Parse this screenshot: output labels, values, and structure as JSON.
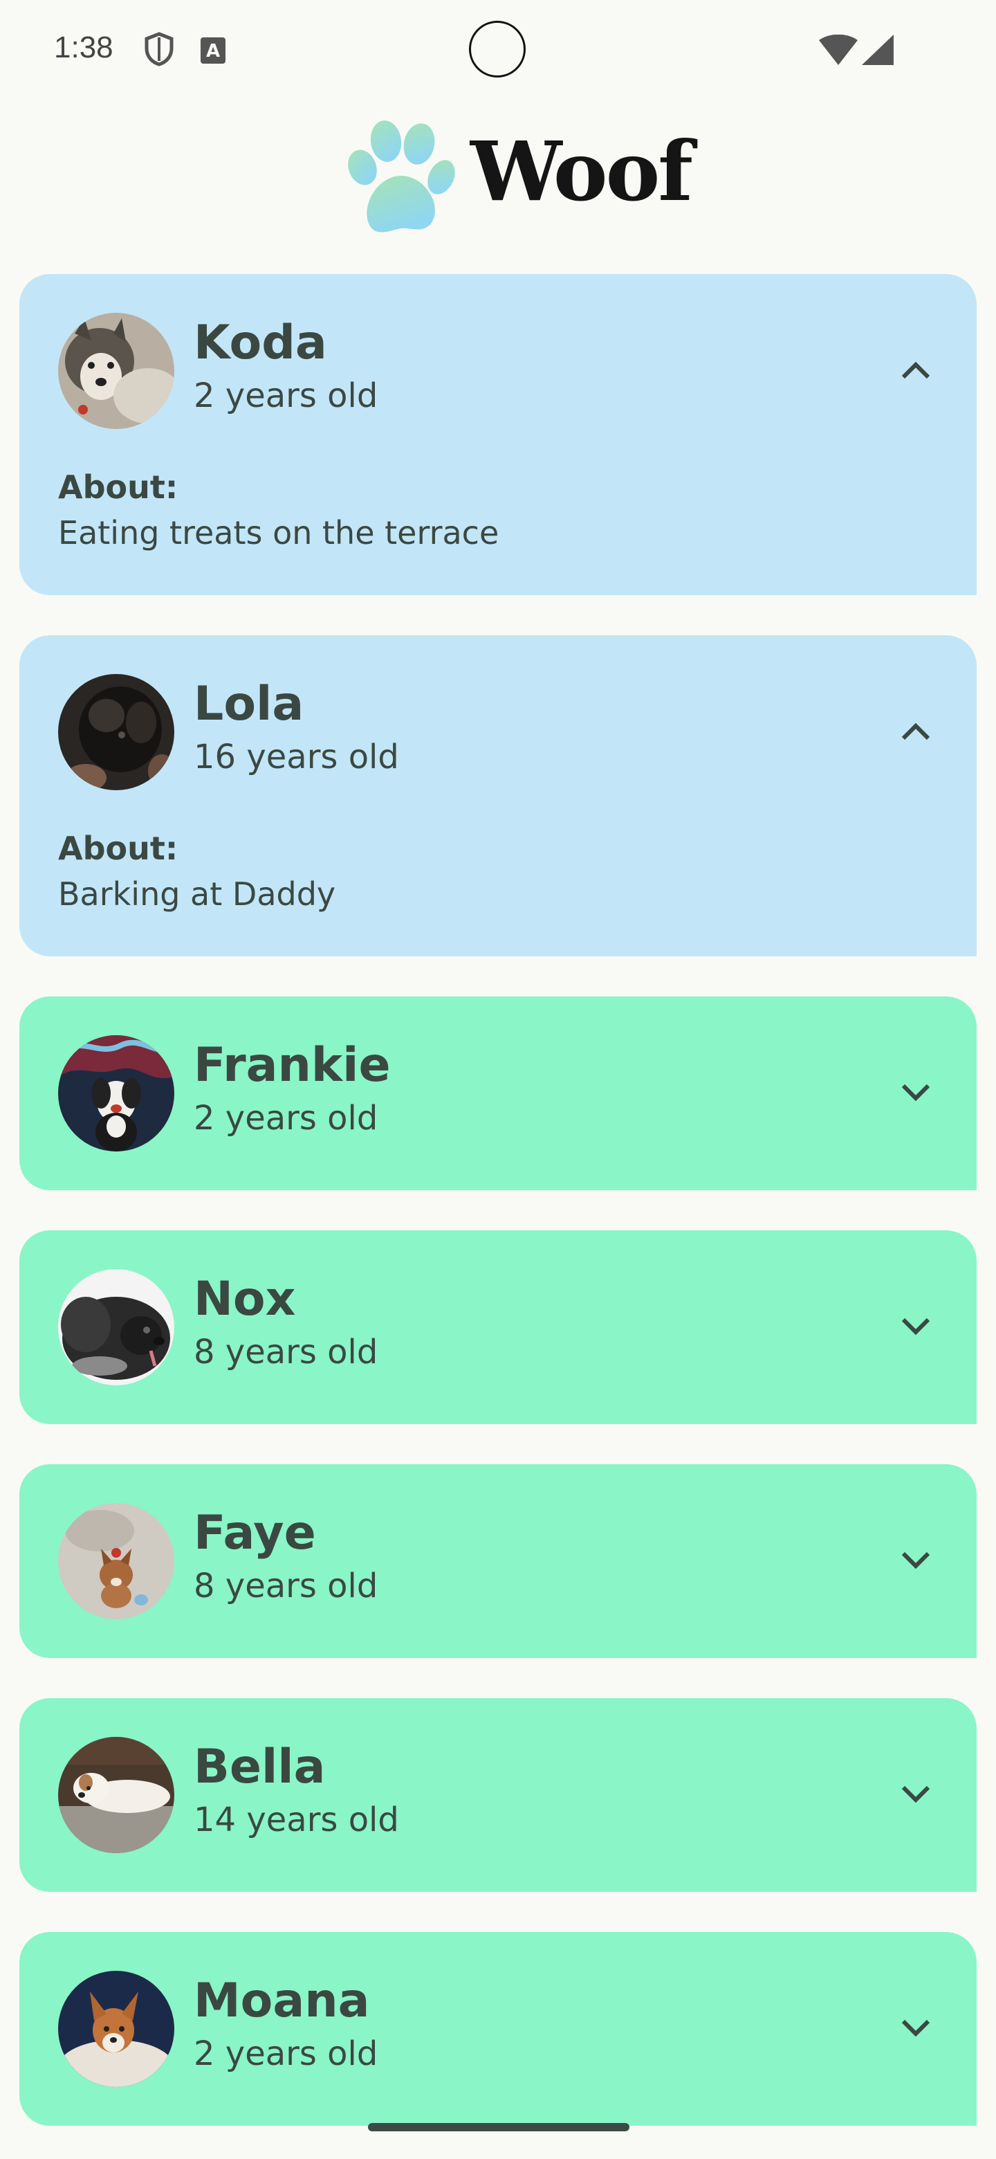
{
  "status_bar": {
    "time": "1:38",
    "icons": [
      "shield-icon",
      "accessibility-a-icon",
      "wifi-icon",
      "cellular-signal-icon"
    ]
  },
  "app_bar": {
    "title": "Woof",
    "logo": "paw-icon"
  },
  "dogs": [
    {
      "name": "Koda",
      "age": "2 years old",
      "expanded": true,
      "about_label": "About:",
      "about": "Eating treats on the terrace",
      "toggle_icon": "chevron-up-icon"
    },
    {
      "name": "Lola",
      "age": "16 years old",
      "expanded": true,
      "about_label": "About:",
      "about": "Barking at Daddy",
      "toggle_icon": "chevron-up-icon"
    },
    {
      "name": "Frankie",
      "age": "2 years old",
      "expanded": false,
      "toggle_icon": "chevron-down-icon"
    },
    {
      "name": "Nox",
      "age": "8 years old",
      "expanded": false,
      "toggle_icon": "chevron-down-icon"
    },
    {
      "name": "Faye",
      "age": "8 years old",
      "expanded": false,
      "toggle_icon": "chevron-down-icon"
    },
    {
      "name": "Bella",
      "age": "14 years old",
      "expanded": false,
      "toggle_icon": "chevron-down-icon"
    },
    {
      "name": "Moana",
      "age": "2 years old",
      "expanded": false,
      "toggle_icon": "chevron-down-icon"
    }
  ],
  "colors": {
    "background": "#f9faf6",
    "expanded_card": "#c2e6f7",
    "collapsed_card": "#8af5c7",
    "text": "#3b4842"
  }
}
